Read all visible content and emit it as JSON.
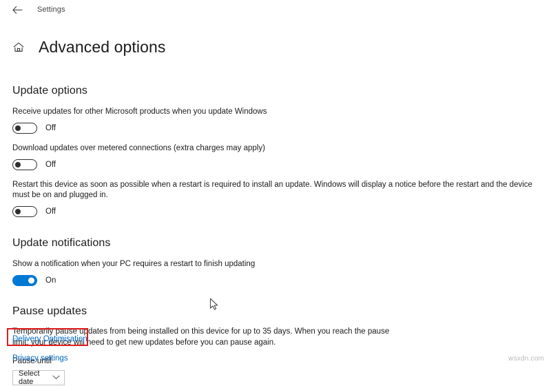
{
  "window": {
    "app_title": "Settings",
    "back_icon": "back-arrow-icon",
    "home_icon": "home-icon",
    "page_title": "Advanced options"
  },
  "sections": {
    "update_options": {
      "heading": "Update options",
      "settings": [
        {
          "label": "Receive updates for other Microsoft products when you update Windows",
          "state": "Off",
          "on": false
        },
        {
          "label": "Download updates over metered connections (extra charges may apply)",
          "state": "Off",
          "on": false
        },
        {
          "label": "Restart this device as soon as possible when a restart is required to install an update. Windows will display a notice before the restart and the device must be on and plugged in.",
          "state": "Off",
          "on": false
        }
      ]
    },
    "update_notifications": {
      "heading": "Update notifications",
      "settings": [
        {
          "label": "Show a notification when your PC requires a restart to finish updating",
          "state": "On",
          "on": true
        }
      ]
    },
    "pause_updates": {
      "heading": "Pause updates",
      "description": "Temporarily pause updates from being installed on this device for up to 35 days. When you reach the pause limit, your device will need to get new updates before you can pause again.",
      "field_label": "Pause until",
      "dropdown": {
        "value": "Select date",
        "chevron_icon": "chevron-down-icon"
      }
    }
  },
  "links": {
    "delivery_optimisation": "Delivery Optimisation",
    "privacy_settings": "Privacy settings"
  },
  "annotation": {
    "highlight_color": "#e01b1b",
    "target": "Delivery Optimisation"
  },
  "colors": {
    "accent": "#0078d4",
    "link": "#0067c0",
    "text": "#1b1b1b"
  },
  "watermark": "wsxdn.com"
}
